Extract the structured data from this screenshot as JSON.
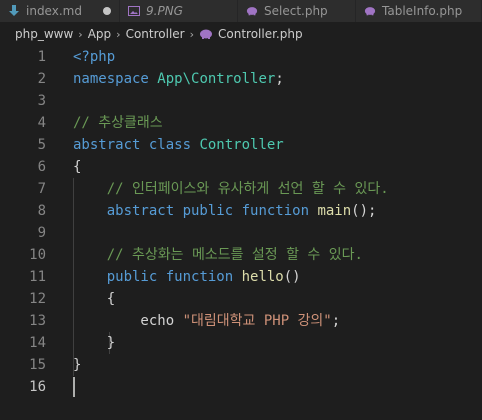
{
  "tabs": [
    {
      "label": "index.md",
      "icon": "download-arrow-icon",
      "dirty": true
    },
    {
      "label": "9.PNG",
      "icon": "image-icon"
    },
    {
      "label": "Select.php",
      "icon": "php-elephant-icon"
    },
    {
      "label": "TableInfo.php",
      "icon": "php-elephant-icon"
    }
  ],
  "breadcrumb": {
    "root": "php_www",
    "folder1": "App",
    "folder2": "Controller",
    "file": "Controller.php"
  },
  "lines": [
    {
      "n": "1",
      "tokens": [
        {
          "t": "<?php",
          "c": "tag"
        }
      ]
    },
    {
      "n": "2",
      "tokens": [
        {
          "t": "namespace ",
          "c": "blue"
        },
        {
          "t": "App\\Controller",
          "c": "teal"
        },
        {
          "t": ";",
          "c": "plain"
        }
      ]
    },
    {
      "n": "3",
      "tokens": []
    },
    {
      "n": "4",
      "tokens": [
        {
          "t": "// 추상클래스",
          "c": "comment"
        }
      ]
    },
    {
      "n": "5",
      "tokens": [
        {
          "t": "abstract ",
          "c": "blue"
        },
        {
          "t": "class ",
          "c": "blue"
        },
        {
          "t": "Controller",
          "c": "teal"
        }
      ]
    },
    {
      "n": "6",
      "tokens": [
        {
          "t": "{",
          "c": "plain"
        }
      ]
    },
    {
      "n": "7",
      "tokens": [
        {
          "t": "    // 인터페이스와 유사하게 선언 할 수 있다.",
          "c": "comment"
        }
      ]
    },
    {
      "n": "8",
      "tokens": [
        {
          "t": "    ",
          "c": "plain"
        },
        {
          "t": "abstract ",
          "c": "blue"
        },
        {
          "t": "public ",
          "c": "blue"
        },
        {
          "t": "function ",
          "c": "blue"
        },
        {
          "t": "main",
          "c": "func"
        },
        {
          "t": "();",
          "c": "plain"
        }
      ]
    },
    {
      "n": "9",
      "tokens": []
    },
    {
      "n": "10",
      "tokens": [
        {
          "t": "    // 추상화는 메소드를 설정 할 수 있다.",
          "c": "comment"
        }
      ]
    },
    {
      "n": "11",
      "tokens": [
        {
          "t": "    ",
          "c": "plain"
        },
        {
          "t": "public ",
          "c": "blue"
        },
        {
          "t": "function ",
          "c": "blue"
        },
        {
          "t": "hello",
          "c": "func"
        },
        {
          "t": "()",
          "c": "plain"
        }
      ]
    },
    {
      "n": "12",
      "tokens": [
        {
          "t": "    {",
          "c": "plain"
        }
      ]
    },
    {
      "n": "13",
      "tokens": [
        {
          "t": "        echo ",
          "c": "plain"
        },
        {
          "t": "\"대림대학교 PHP 강의\"",
          "c": "str"
        },
        {
          "t": ";",
          "c": "plain"
        }
      ]
    },
    {
      "n": "14",
      "tokens": [
        {
          "t": "    }",
          "c": "plain"
        }
      ]
    },
    {
      "n": "15",
      "tokens": [
        {
          "t": "}",
          "c": "plain"
        }
      ]
    },
    {
      "n": "16",
      "tokens": [],
      "active": true
    }
  ],
  "colors": {
    "background": "#1e1e1e",
    "keyword": "#569cd6",
    "type": "#4ec9b0",
    "comment": "#6a9955",
    "function": "#dcdcaa",
    "string": "#ce9178",
    "php_icon": "#a074c4",
    "markdown_icon": "#519aba"
  }
}
